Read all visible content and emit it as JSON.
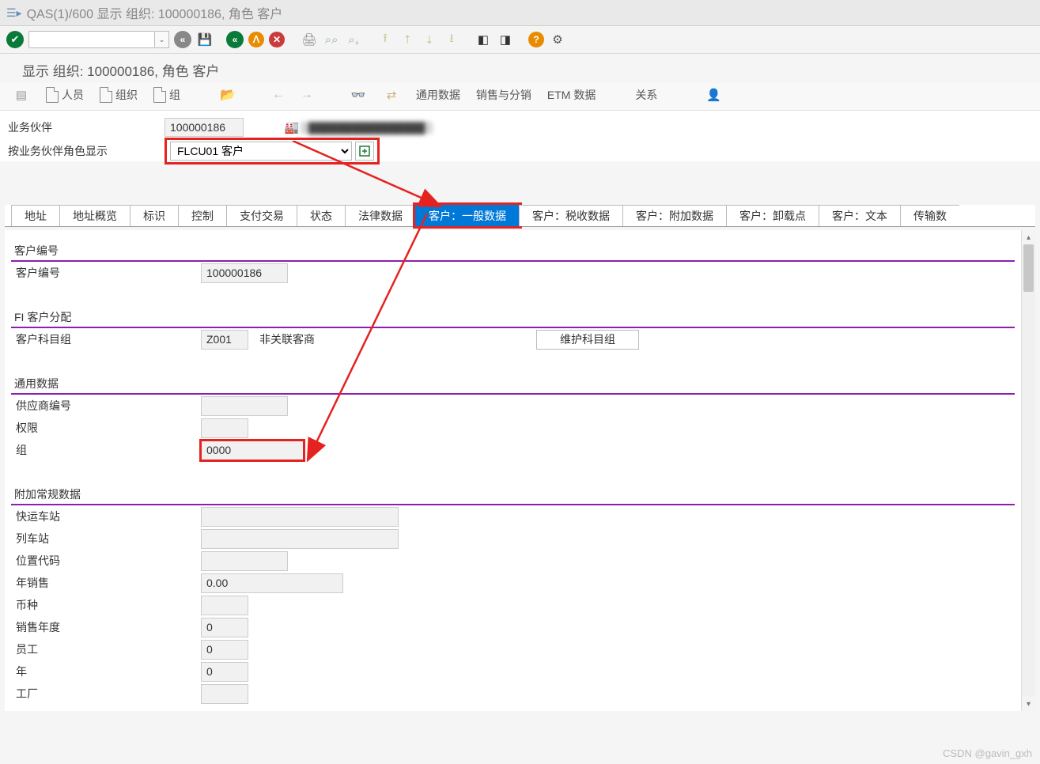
{
  "window": {
    "title": "QAS(1)/600 显示 组织: 100000186, 角色 客户"
  },
  "subtitle": "显示 组织: 100000186, 角色 客户",
  "app_toolbar": {
    "person": "人员",
    "org": "组织",
    "group": "组",
    "general": "通用数据",
    "sales": "销售与分销",
    "etm": "ETM 数据",
    "rel": "关系"
  },
  "hdr": {
    "bp_label": "业务伙伴",
    "bp_value": "100000186",
    "role_label": "按业务伙伴角色显示",
    "role_value": "FLCU01 客户",
    "blur_text": "████████████████"
  },
  "tabs": {
    "addr": "地址",
    "addr_ov": "地址概览",
    "ident": "标识",
    "ctrl": "控制",
    "pay": "支付交易",
    "status": "状态",
    "legal": "法律数据",
    "cust_gen": "客户：一般数据",
    "cust_tax": "客户：税收数据",
    "cust_add": "客户：附加数据",
    "cust_unl": "客户：卸载点",
    "cust_txt": "客户：文本",
    "trans": "传输数"
  },
  "g_custno": {
    "title": "客户编号",
    "lbl": "客户编号",
    "val": "100000186"
  },
  "g_fi": {
    "title": "FI 客户分配",
    "lbl": "客户科目组",
    "val": "Z001",
    "txt": "非关联客商",
    "btn": "维护科目组"
  },
  "g_gen": {
    "title": "通用数据",
    "supplier_lbl": "供应商编号",
    "supplier_val": "",
    "auth_lbl": "权限",
    "auth_val": "",
    "group_lbl": "组",
    "group_val": "0000"
  },
  "g_add": {
    "title": "附加常规数据",
    "express_lbl": "快运车站",
    "express_val": "",
    "train_lbl": "列车站",
    "train_val": "",
    "loc_lbl": "位置代码",
    "loc_val": "",
    "annual_lbl": "年销售",
    "annual_val": "0.00",
    "curr_lbl": "币种",
    "curr_val": "",
    "salesyr_lbl": "销售年度",
    "salesyr_val": "0",
    "emp_lbl": "员工",
    "emp_val": "0",
    "year_lbl": "年",
    "year_val": "0",
    "plant_lbl": "工厂",
    "plant_val": ""
  },
  "watermark": "CSDN @gavin_gxh"
}
